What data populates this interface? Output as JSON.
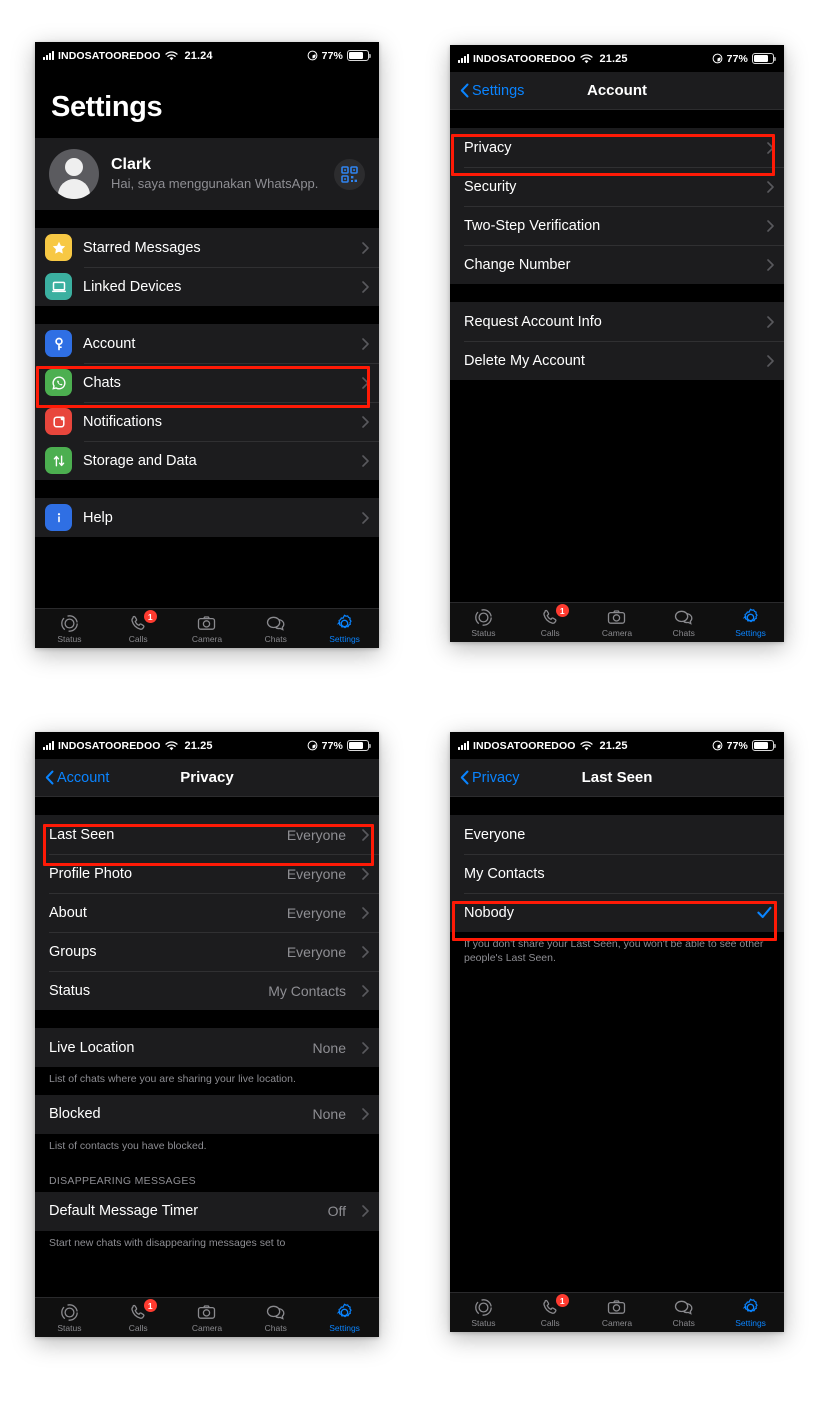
{
  "meta": {
    "app": "WhatsApp",
    "platform": "iOS",
    "accent_blue": "#0a84ff",
    "highlight_red": "#ff1a06",
    "page_background": "#ffffff",
    "screen_background": "#000000",
    "row_background": "#1c1c1e"
  },
  "status_bar": {
    "carrier": "INDOSATOOREDOO",
    "time_1": "21.24",
    "time_2": "21.25",
    "battery_percent": "77%",
    "wifi_icon": "wifi-icon",
    "signal_icon": "cellular-bars-icon",
    "battery_icon": "battery-icon",
    "dnd_icon": "do-not-disturb-icon"
  },
  "tab_bar": {
    "items": [
      {
        "label": "Status",
        "icon": "status-rings-icon",
        "active": false,
        "badge": ""
      },
      {
        "label": "Calls",
        "icon": "phone-icon",
        "active": false,
        "badge": "1"
      },
      {
        "label": "Camera",
        "icon": "camera-icon",
        "active": false,
        "badge": ""
      },
      {
        "label": "Chats",
        "icon": "chat-bubbles-icon",
        "active": false,
        "badge": ""
      },
      {
        "label": "Settings",
        "icon": "gear-icon",
        "active": true,
        "badge": ""
      }
    ]
  },
  "screen1": {
    "title": "Settings",
    "profile": {
      "name": "Clark",
      "status": "Hai, saya menggunakan WhatsApp.",
      "qr_icon": "qr-code-icon",
      "avatar_icon": "person-avatar-icon"
    },
    "group1": [
      {
        "label": "Starred Messages",
        "icon": "star-icon",
        "icon_color": "#f7c844"
      },
      {
        "label": "Linked Devices",
        "icon": "laptop-icon",
        "icon_color": "#3bb0a0"
      }
    ],
    "group2": [
      {
        "label": "Account",
        "icon": "key-icon",
        "icon_color": "#2f6fe4",
        "highlighted": true
      },
      {
        "label": "Chats",
        "icon": "whatsapp-icon",
        "icon_color": "#4caf50"
      },
      {
        "label": "Notifications",
        "icon": "bell-dot-icon",
        "icon_color": "#e8463c"
      },
      {
        "label": "Storage and Data",
        "icon": "data-arrows-icon",
        "icon_color": "#4caf50"
      }
    ],
    "group3": [
      {
        "label": "Help",
        "icon": "info-icon",
        "icon_color": "#2f6fe4"
      }
    ]
  },
  "screen2": {
    "nav": {
      "back_label": "Settings",
      "title": "Account"
    },
    "group1": [
      {
        "label": "Privacy",
        "highlighted": true
      },
      {
        "label": "Security",
        "highlighted": false
      },
      {
        "label": "Two-Step Verification",
        "highlighted": false
      },
      {
        "label": "Change Number",
        "highlighted": false
      }
    ],
    "group2": [
      {
        "label": "Request Account Info"
      },
      {
        "label": "Delete My Account"
      }
    ]
  },
  "screen3": {
    "nav": {
      "back_label": "Account",
      "title": "Privacy"
    },
    "group1": [
      {
        "label": "Last Seen",
        "value": "Everyone",
        "highlighted": true
      },
      {
        "label": "Profile Photo",
        "value": "Everyone",
        "highlighted": false
      },
      {
        "label": "About",
        "value": "Everyone",
        "highlighted": false
      },
      {
        "label": "Groups",
        "value": "Everyone",
        "highlighted": false
      },
      {
        "label": "Status",
        "value": "My Contacts",
        "highlighted": false
      }
    ],
    "live_location": {
      "label": "Live Location",
      "value": "None"
    },
    "live_location_note": "List of chats where you are sharing your live location.",
    "blocked": {
      "label": "Blocked",
      "value": "None"
    },
    "blocked_note": "List of contacts you have blocked.",
    "section_header": "DISAPPEARING MESSAGES",
    "default_timer": {
      "label": "Default Message Timer",
      "value": "Off"
    },
    "default_timer_note": "Start new chats with disappearing messages set to"
  },
  "screen4": {
    "nav": {
      "back_label": "Privacy",
      "title": "Last Seen"
    },
    "options": [
      {
        "label": "Everyone",
        "selected": false,
        "highlighted": false
      },
      {
        "label": "My Contacts",
        "selected": false,
        "highlighted": false
      },
      {
        "label": "Nobody",
        "selected": true,
        "highlighted": true
      }
    ],
    "note": "If you don't share your Last Seen, you won't be able to see other people's Last Seen."
  }
}
